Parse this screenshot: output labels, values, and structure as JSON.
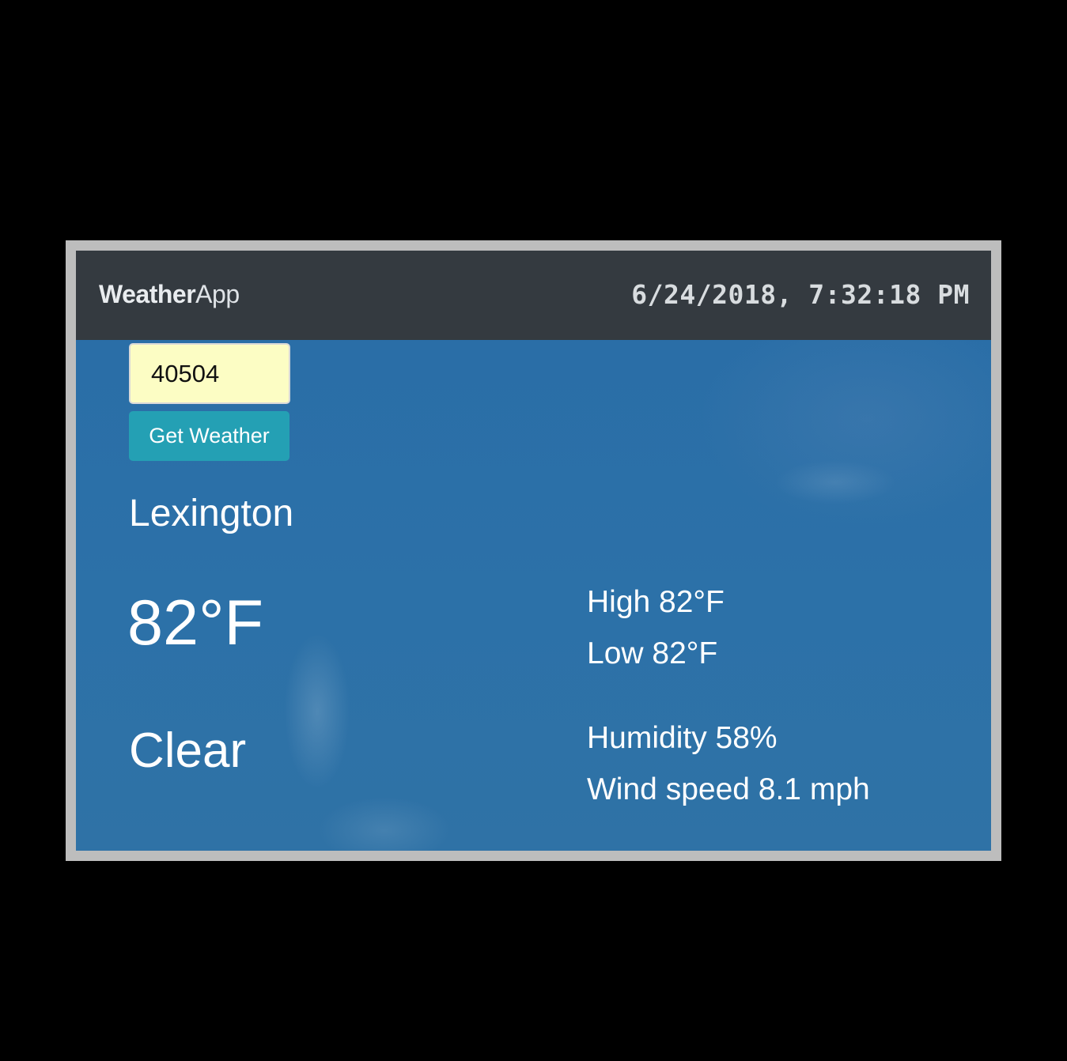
{
  "navbar": {
    "brand_bold": "Weather",
    "brand_light": "App",
    "datetime": "6/24/2018, 7:32:18 PM"
  },
  "search": {
    "zip_value": "40504",
    "button_label": "Get Weather"
  },
  "weather": {
    "city": "Lexington",
    "temperature": "82°F",
    "condition": "Clear",
    "high": "High 82°F",
    "low": "Low 82°F",
    "humidity": "Humidity 58%",
    "wind_speed": "Wind speed 8.1 mph"
  },
  "colors": {
    "navbar": "#343a40",
    "sky": "#2b6fa6",
    "input_background": "#fcfdc4",
    "button": "#24a0b4",
    "frame": "#bdbdbd"
  }
}
